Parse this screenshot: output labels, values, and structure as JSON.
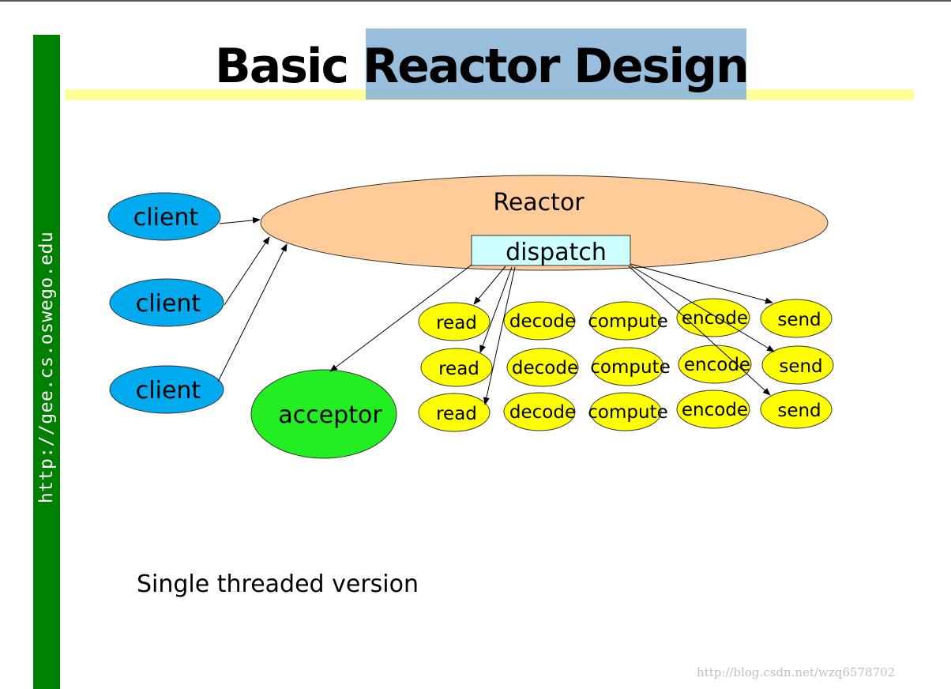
{
  "slide": {
    "title_prefix": "Basic",
    "title_highlight": "Reactor Design",
    "sidebar_url": "http://gee.cs.oswego.edu",
    "caption": "Single threaded version",
    "watermark": "http://blog.csdn.net/wzq6578702",
    "colors": {
      "sidebar": "#008000",
      "title_highlight": "#8fb8d8",
      "title_underline": "#ffff99",
      "client": "#00aaee",
      "reactor": "#ffcc99",
      "dispatch": "#ccffff",
      "acceptor": "#22ee22",
      "handler": "#ffff00"
    }
  },
  "diagram": {
    "reactor": {
      "label": "Reactor",
      "dispatch_label": "dispatch"
    },
    "clients": [
      "client",
      "client",
      "client"
    ],
    "acceptor": "acceptor",
    "handler_rows": [
      [
        "read",
        "decode",
        "compute",
        "encode",
        "send"
      ],
      [
        "read",
        "decode",
        "compute",
        "encode",
        "send"
      ],
      [
        "read",
        "decode",
        "compute",
        "encode",
        "send"
      ]
    ]
  }
}
